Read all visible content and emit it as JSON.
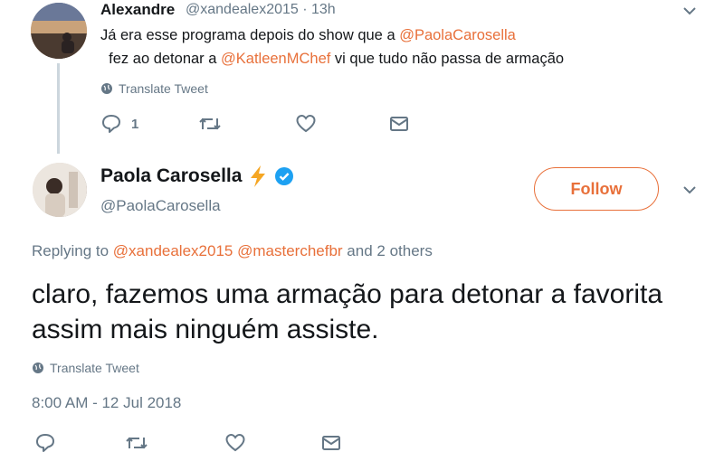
{
  "reply_tweet": {
    "author_name": "Alexandre",
    "handle_time": "@xandealex2015 · 13h",
    "text_1": "Já era esse programa depois do show que a ",
    "mention_1": "@PaolaCarosella",
    "text_2": "  fez ao detonar a ",
    "mention_2": "@KatleenMChef",
    "text_3": " vi que tudo não passa de armação",
    "translate_label": "Translate Tweet",
    "reply_count": "1"
  },
  "main_tweet": {
    "author_name": "Paola Carosella",
    "badge_icon": "lightning-icon",
    "handle": "@PaolaCarosella",
    "follow_label": "Follow",
    "replying_prefix": "Replying to ",
    "replying_mention_1": "@xandealex2015",
    "replying_mention_2": "@masterchefbr",
    "replying_suffix": " and 2 others",
    "text": "claro, fazemos uma armação para detonar a favorita assim mais ninguém assiste.",
    "translate_label": "Translate Tweet",
    "timestamp": "8:00 AM - 12 Jul 2018"
  },
  "colors": {
    "accent": "#e8703a",
    "muted": "#657786",
    "text": "#14171a",
    "verified": "#1da1f2",
    "lightning": "#f5a623"
  }
}
